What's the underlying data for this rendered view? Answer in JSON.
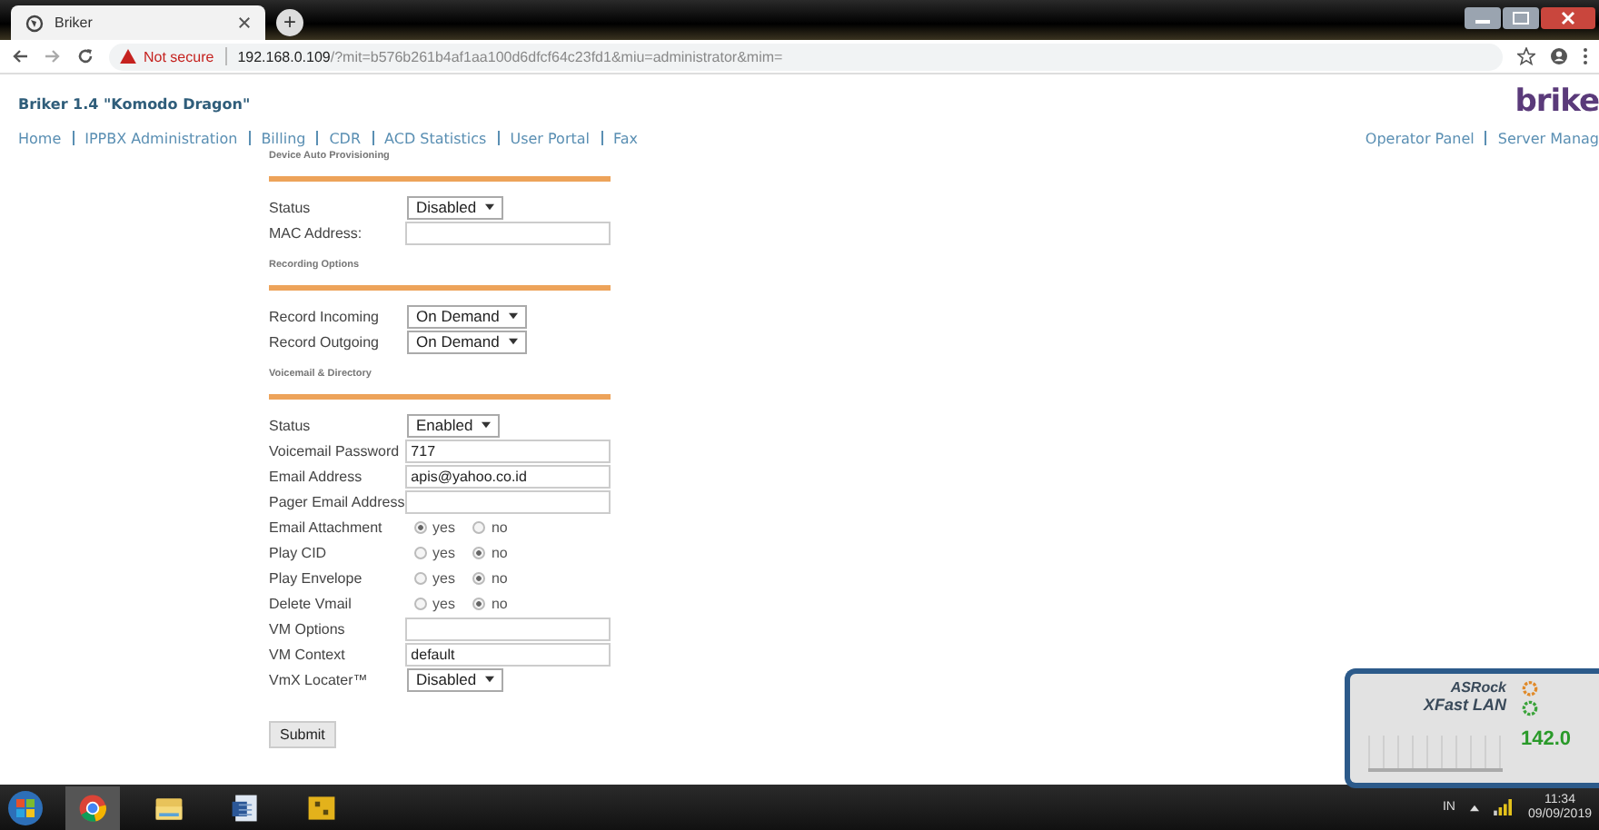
{
  "browser": {
    "tab_title": "Briker",
    "new_tab": "+",
    "security": "Not secure",
    "url_host": "192.168.0.109",
    "url_rest": "/?mit=b576b261b4af1aa100d6dfcf64c23fd1&miu=administrator&mim="
  },
  "header": {
    "brand": "Briker 1.4 \"Komodo Dragon\"",
    "logo": "brike"
  },
  "nav_left": [
    "Home",
    "IPPBX Administration",
    "Billing",
    "CDR",
    "ACD Statistics",
    "User Portal",
    "Fax"
  ],
  "nav_right": [
    "Operator Panel",
    "Server Manag"
  ],
  "sections": [
    {
      "title": "Device Auto Provisioning",
      "fields": [
        {
          "kind": "select",
          "label": "Status",
          "value": "Disabled"
        },
        {
          "kind": "text",
          "label": "MAC Address:"
        }
      ]
    },
    {
      "title": "Recording Options",
      "fields": [
        {
          "kind": "select",
          "label": "Record Incoming",
          "value": "On Demand"
        },
        {
          "kind": "select",
          "label": "Record Outgoing",
          "value": "On Demand"
        }
      ]
    },
    {
      "title": "Voicemail & Directory",
      "fields": [
        {
          "kind": "select",
          "label": "Status",
          "value": "Enabled"
        },
        {
          "kind": "text",
          "label": "Voicemail Password",
          "value": "717"
        },
        {
          "kind": "text",
          "label": "Email Address",
          "value": "apis@yahoo.co.id"
        },
        {
          "kind": "text",
          "label": "Pager Email Address"
        },
        {
          "kind": "radio",
          "label": "Email Attachment",
          "options": [
            {
              "label": "yes",
              "selected": true
            },
            {
              "label": "no",
              "selected": false
            }
          ]
        },
        {
          "kind": "radio",
          "label": "Play CID",
          "options": [
            {
              "label": "yes",
              "selected": false
            },
            {
              "label": "no",
              "selected": true
            }
          ]
        },
        {
          "kind": "radio",
          "label": "Play Envelope",
          "options": [
            {
              "label": "yes",
              "selected": false
            },
            {
              "label": "no",
              "selected": true
            }
          ]
        },
        {
          "kind": "radio",
          "label": "Delete Vmail",
          "options": [
            {
              "label": "yes",
              "selected": false
            },
            {
              "label": "no",
              "selected": true
            }
          ]
        },
        {
          "kind": "text",
          "label": "VM Options"
        },
        {
          "kind": "text",
          "label": "VM Context",
          "value": "default"
        },
        {
          "kind": "select",
          "label": "VmX Locater™",
          "value": "Disabled"
        }
      ]
    }
  ],
  "submit": "Submit",
  "widget": {
    "brand": "ASRock",
    "product": "XFast LAN",
    "reading": "142.0"
  },
  "taskbar": {
    "language": "IN",
    "time": "11:34",
    "date": "09/09/2019"
  }
}
